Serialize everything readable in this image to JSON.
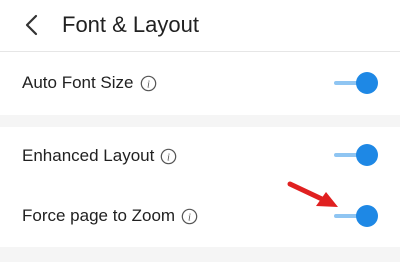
{
  "header": {
    "title": "Font & Layout"
  },
  "settings": [
    {
      "label": "Auto Font Size",
      "enabled": true
    },
    {
      "label": "Enhanced Layout",
      "enabled": true
    },
    {
      "label": "Force page to Zoom",
      "enabled": true
    }
  ],
  "colors": {
    "accent": "#1e88e5",
    "track": "#8fc5f2",
    "annotation_arrow": "#e02020",
    "section_gap": "#f5f5f5"
  },
  "icons": {
    "back": "chevron-left-icon",
    "info": "info-icon",
    "annotation": "red-arrow-icon"
  }
}
